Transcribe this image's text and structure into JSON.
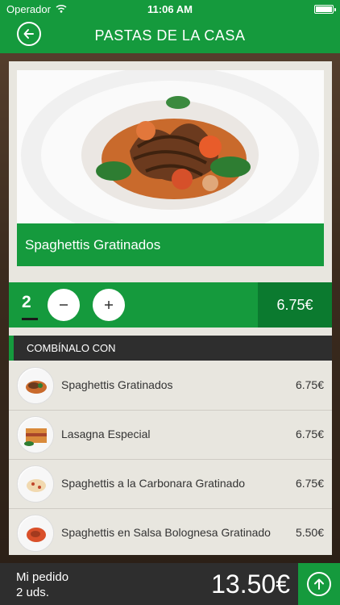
{
  "status_bar": {
    "carrier": "Operador",
    "time": "11:06 AM"
  },
  "nav": {
    "title": "PASTAS DE LA CASA",
    "back_icon": "back-arrow-icon"
  },
  "product": {
    "name": "Spaghettis Gratinados",
    "quantity": "2",
    "price": "6.75€",
    "image_icon": "pasta-dish-photo"
  },
  "combo": {
    "header": "COMBÍNALO CON",
    "items": [
      {
        "name": "Spaghettis Gratinados",
        "price": "6.75€"
      },
      {
        "name": "Lasagna Especial",
        "price": "6.75€"
      },
      {
        "name": "Spaghettis a la Carbonara Gratinado",
        "price": "6.75€"
      },
      {
        "name": "Spaghettis en Salsa Bolognesa Gratinado",
        "price": "5.50€"
      }
    ]
  },
  "order": {
    "label": "Mi pedido",
    "count": "2 uds.",
    "total": "13.50€"
  },
  "colors": {
    "brand_green": "#159a3d",
    "dark_green": "#0b7a2f",
    "dark_bar": "#2e2e2e"
  }
}
